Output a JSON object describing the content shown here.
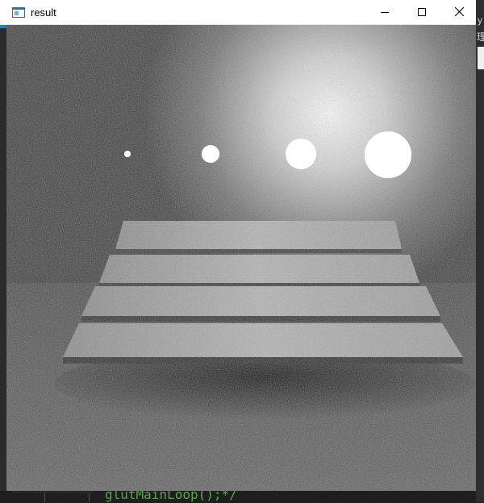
{
  "window": {
    "title": "result",
    "icon": "app-window-icon",
    "controls": {
      "minimize": "minimize-icon",
      "maximize": "maximize-icon",
      "close": "close-icon"
    }
  },
  "background": {
    "code_line": "glutMainLoop();*/",
    "right_edge_chars": [
      "y",
      "理"
    ]
  },
  "colors": {
    "titlebar": "#ffffff",
    "viewport_bg": "#3a3a3a",
    "code_comment": "#57a64a"
  }
}
